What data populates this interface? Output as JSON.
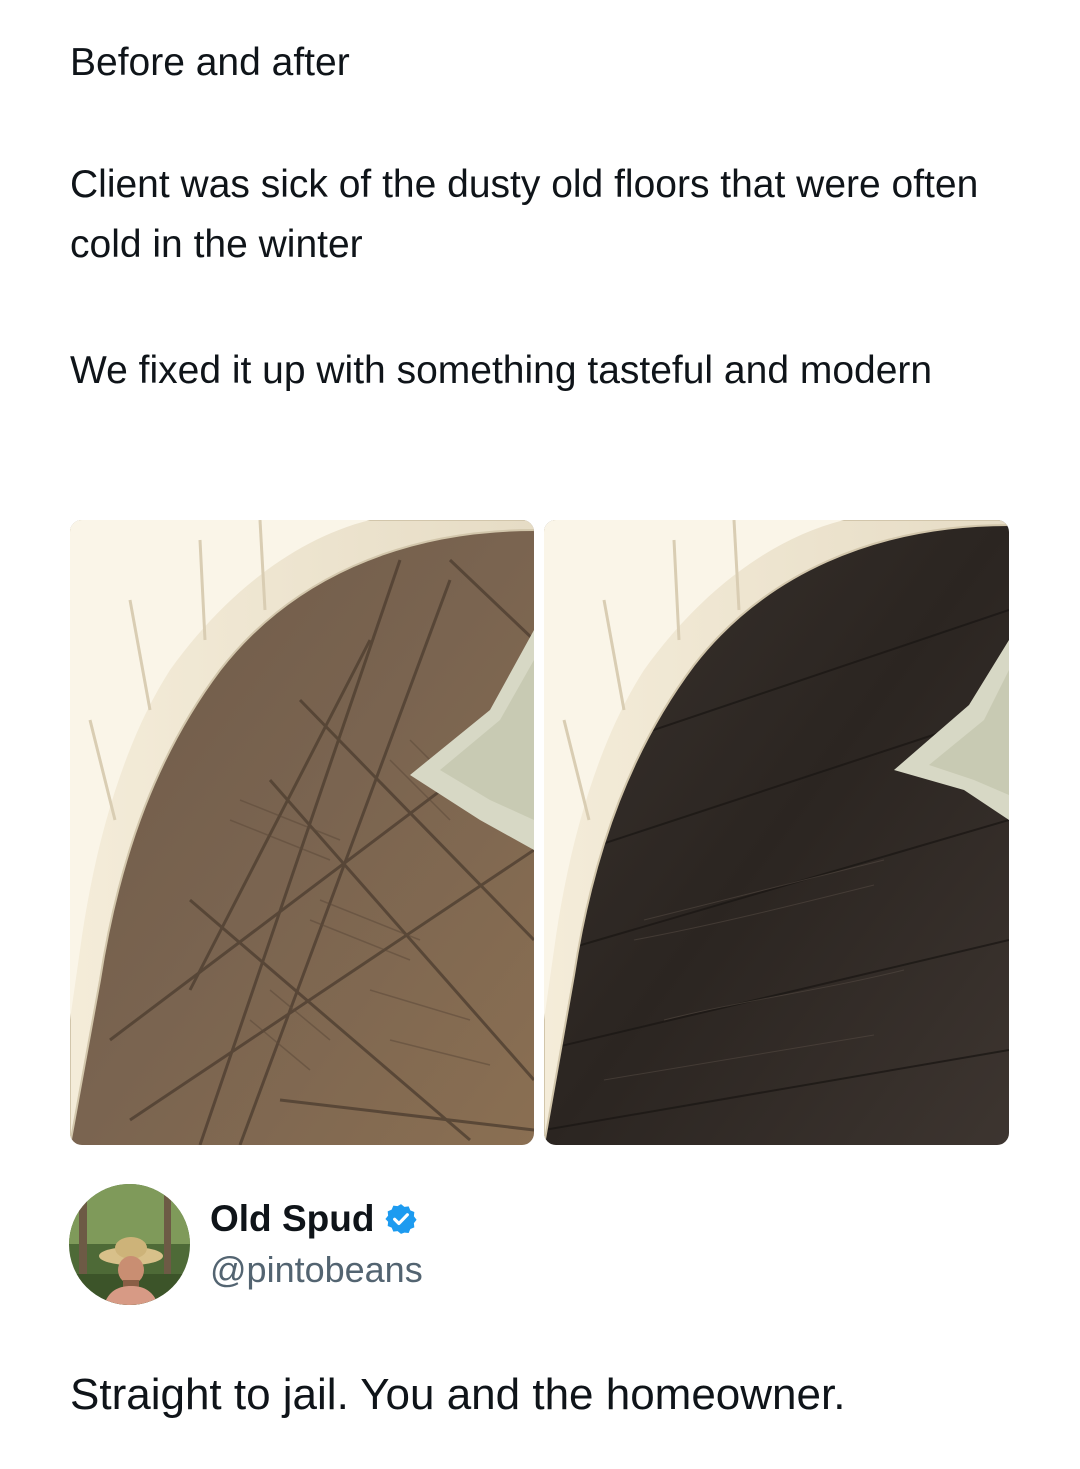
{
  "post": {
    "paragraphs": [
      "Before and after",
      "Client was sick of the dusty old floors that were often cold in the winter",
      "We fixed it up with something tasteful and modern"
    ],
    "images": [
      {
        "label": "before-floor",
        "description_icon": "parquet-floor-image"
      },
      {
        "label": "after-floor",
        "description_icon": "dark-plank-floor-image"
      }
    ]
  },
  "reply": {
    "author": {
      "name": "Old Spud",
      "handle": "@pintobeans",
      "verified": true,
      "badge_color": "#1d9bf0"
    },
    "text": "Straight to jail. You and the homeowner."
  },
  "colors": {
    "text": "#0f1419",
    "secondary_text": "#536471",
    "background": "#ffffff"
  }
}
